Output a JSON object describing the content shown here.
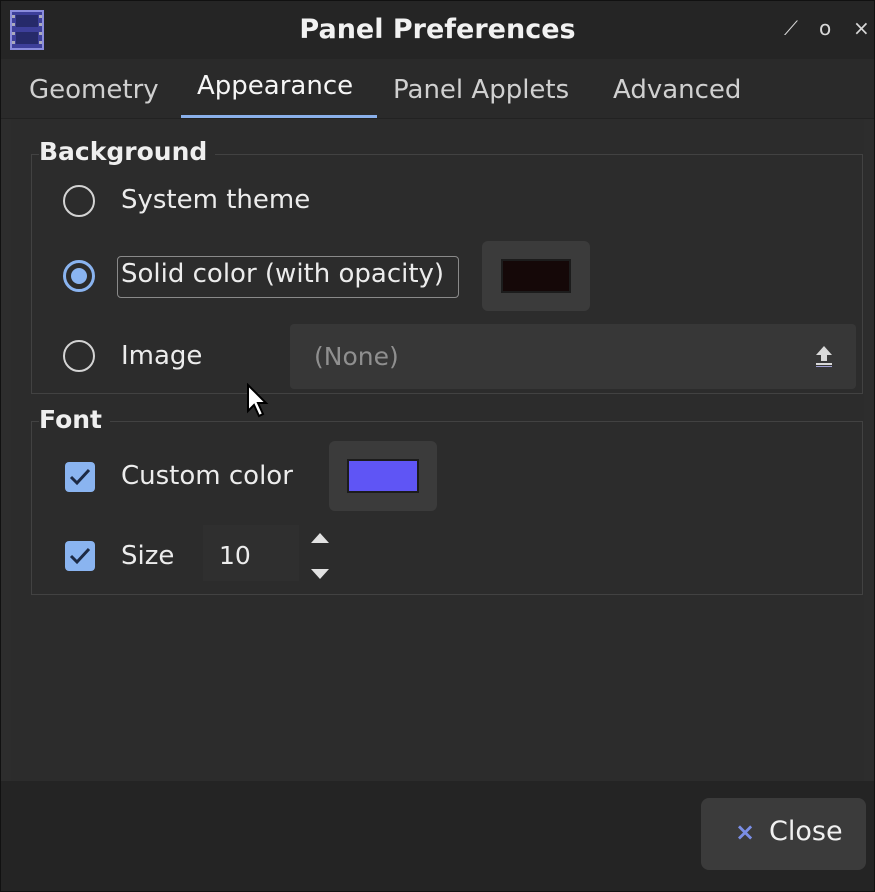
{
  "window": {
    "title": "Panel Preferences",
    "controls": {
      "minimize": "⟋",
      "maximize": "o",
      "close": "×"
    }
  },
  "tabs": [
    {
      "label": "Geometry",
      "active": false
    },
    {
      "label": "Appearance",
      "active": true
    },
    {
      "label": "Panel Applets",
      "active": false
    },
    {
      "label": "Advanced",
      "active": false
    }
  ],
  "background": {
    "title": "Background",
    "options": [
      {
        "label": "System theme",
        "selected": false
      },
      {
        "label": "Solid color (with opacity)",
        "selected": true
      },
      {
        "label": "Image",
        "selected": false
      }
    ],
    "solid_color": "#150808",
    "image_placeholder": "(None)",
    "image_button_icon": "upload-icon"
  },
  "font": {
    "title": "Font",
    "custom_color": {
      "label": "Custom color",
      "checked": true,
      "color": "#5f55f5"
    },
    "size": {
      "label": "Size",
      "checked": true,
      "value": "10"
    }
  },
  "footer": {
    "close_label": "Close",
    "close_icon": "close-icon"
  },
  "colors": {
    "accent": "#8ab4f0",
    "window_bg": "#2d2d2d"
  }
}
